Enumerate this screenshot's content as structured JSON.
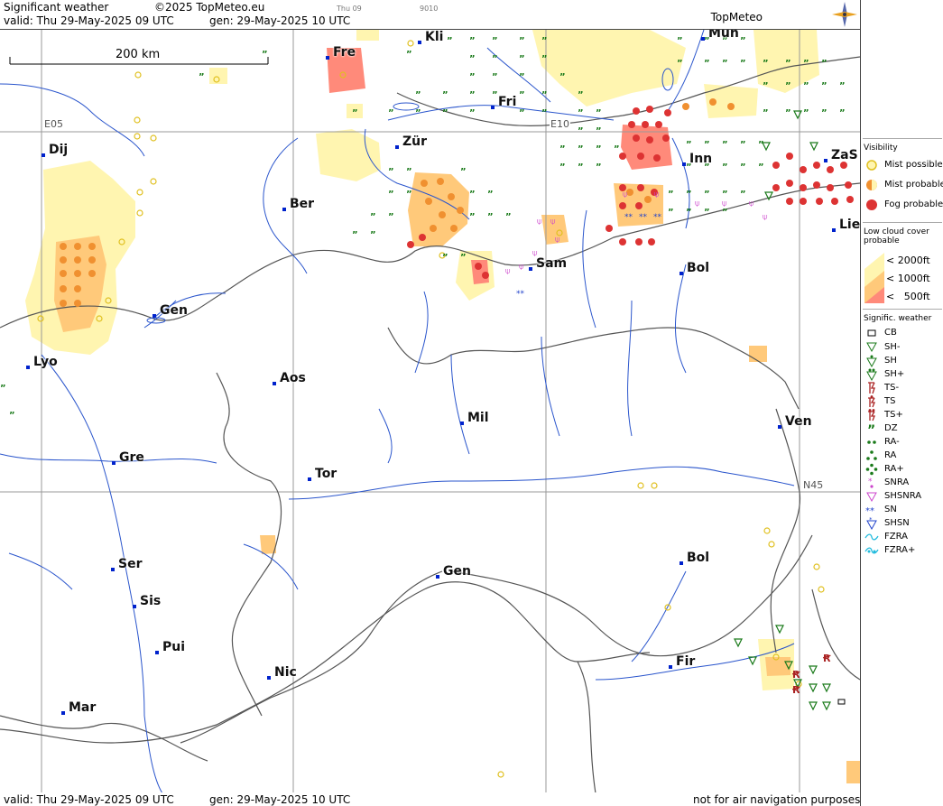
{
  "header": {
    "title": "Significant weather",
    "copyright": "©2025 TopMeteo.eu",
    "valid": "valid:  Thu   29-May-2025  09 UTC",
    "generated": "gen:  29-May-2025 10 UTC",
    "tiny_day": "Thu 09",
    "tiny_code": "9010",
    "brand": "TopMeteo"
  },
  "footer": {
    "valid": "valid:  Thu   29-May-2025  09 UTC",
    "generated": "gen:  29-May-2025 10 UTC",
    "disclaimer": "not for air navigation purposes"
  },
  "map": {
    "scale_label": "200 km",
    "grid_labels": {
      "e05": "E05",
      "e10": "E10",
      "n45": "N45"
    },
    "cities": [
      {
        "id": "fre",
        "name": "Fre"
      },
      {
        "id": "kli",
        "name": "Kli"
      },
      {
        "id": "mun",
        "name": "Mun"
      },
      {
        "id": "fri",
        "name": "Fri"
      },
      {
        "id": "dij",
        "name": "Dij"
      },
      {
        "id": "zur",
        "name": "Zür"
      },
      {
        "id": "inn",
        "name": "Inn"
      },
      {
        "id": "zas",
        "name": "ZaS"
      },
      {
        "id": "ber",
        "name": "Ber"
      },
      {
        "id": "lie",
        "name": "Lie"
      },
      {
        "id": "sam",
        "name": "Sam"
      },
      {
        "id": "bol1",
        "name": "Bol"
      },
      {
        "id": "gen1",
        "name": "Gen"
      },
      {
        "id": "lyo",
        "name": "Lyo"
      },
      {
        "id": "aos",
        "name": "Aos"
      },
      {
        "id": "mil",
        "name": "Mil"
      },
      {
        "id": "ven",
        "name": "Ven"
      },
      {
        "id": "gre",
        "name": "Gre"
      },
      {
        "id": "tor",
        "name": "Tor"
      },
      {
        "id": "ser",
        "name": "Ser"
      },
      {
        "id": "gen2",
        "name": "Gen"
      },
      {
        "id": "bol2",
        "name": "Bol"
      },
      {
        "id": "sis",
        "name": "Sis"
      },
      {
        "id": "pui",
        "name": "Pui"
      },
      {
        "id": "nic",
        "name": "Nic"
      },
      {
        "id": "fir",
        "name": "Fir"
      },
      {
        "id": "mar",
        "name": "Mar"
      }
    ]
  },
  "legend": {
    "visibility_title": "Visibility",
    "mist_possible": "Mist possible",
    "mist_probable": "Mist probable",
    "fog_probable": "Fog probable",
    "low_cloud_title": "Low cloud cover probable",
    "lc_2000": "< 2000ft",
    "lc_1000": "< 1000ft",
    "lc_500": "<   500ft",
    "sigwx_title": "Signific. weather",
    "items": [
      "CB",
      "SH-",
      "SH",
      "SH+",
      "TS-",
      "TS",
      "TS+",
      "DZ",
      "RA-",
      "RA",
      "RA+",
      "SNRA",
      "SHSNRA",
      "SN",
      "SHSN",
      "FZRA",
      "FZRA+"
    ],
    "colors": {
      "lc_2000": "#fff5b0",
      "lc_1000": "#ffc97a",
      "lc_500": "#ff8a7a",
      "fog": "#dd3333",
      "green": "#1a7a1a",
      "tsred": "#aa2222",
      "magenta": "#cc44cc",
      "blue": "#2244cc",
      "cyan": "#22bbdd"
    }
  }
}
